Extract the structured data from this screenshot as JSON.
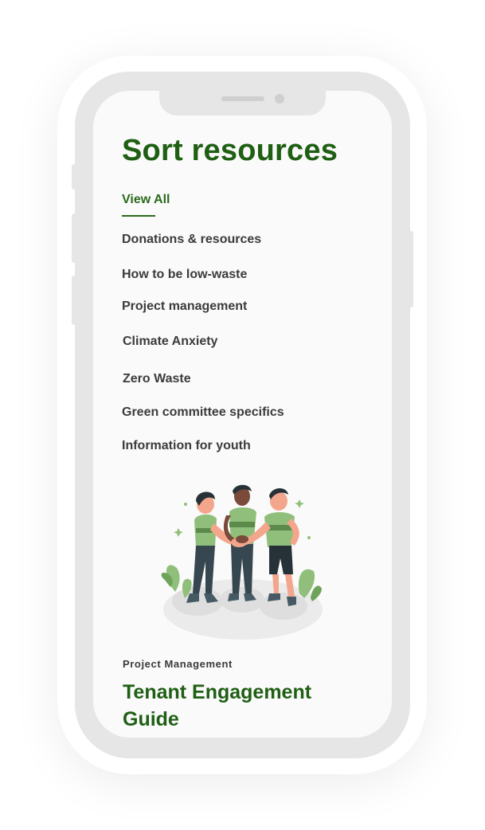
{
  "page": {
    "title": "Sort resources"
  },
  "nav": {
    "items": [
      {
        "label": "View All",
        "active": true
      },
      {
        "label": "Donations & resources"
      },
      {
        "label": "How to be low-waste"
      },
      {
        "label": "Project management"
      },
      {
        "label": "Climate Anxiety"
      },
      {
        "label": "Zero Waste"
      },
      {
        "label": "Green committee specifics"
      },
      {
        "label": "Information for youth"
      }
    ]
  },
  "card": {
    "category": "Project Management",
    "title": "Tenant Engagement Guide",
    "illustration_icon": "team-hands-together-illustration"
  },
  "colors": {
    "accent_green": "#1f5f14",
    "text_dark": "#3b3b3b",
    "phone_frame": "#e6e6e6",
    "screen_bg": "#fafafa"
  }
}
